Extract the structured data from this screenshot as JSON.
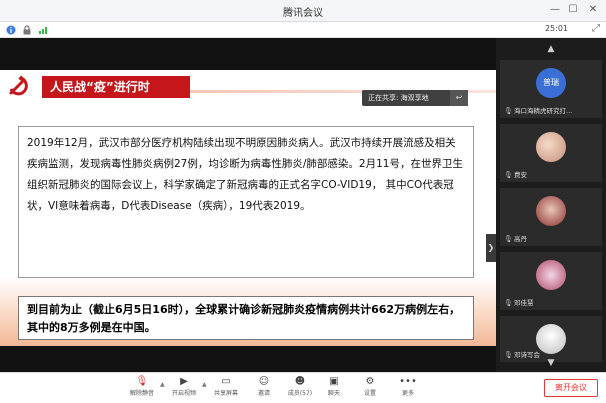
{
  "window": {
    "title": "腾讯会议"
  },
  "status": {
    "time": "25:01"
  },
  "slide": {
    "title": "人民战“疫”进行时",
    "share_tag": "正在共享: 海双享地",
    "paragraph1": "2019年12月，武汉市部分医疗机构陆续出现不明原因肺炎病人。武汉市持续开展流感及相关疾病监测，发现病毒性肺炎病例27例，均诊断为病毒性肺炎/肺部感染。2月11号，在世界卫生组织新冠肺炎的国际会议上，科学家确定了新冠病毒的正式名字CO-VID19， 其中CO代表冠状，VI意味着病毒，D代表Disease（疾病），19代表2019。",
    "paragraph2": "到目前为止（截止6月5日16时），全球累计确诊新冠肺炎疫情病例共计662万病例左右，其中的8万多例是在中国。"
  },
  "participants": [
    {
      "avatar_text": "普瑞",
      "name": "海口海精虎研究打..."
    },
    {
      "avatar_text": "",
      "name": "费安"
    },
    {
      "avatar_text": "",
      "name": "高丹"
    },
    {
      "avatar_text": "",
      "name": "邓佳慧"
    },
    {
      "avatar_text": "",
      "name": "邓诗写会"
    }
  ],
  "toolbar": {
    "items": [
      {
        "icon": "mic-icon",
        "label": "解除静音"
      },
      {
        "icon": "camera-icon",
        "label": "开启视频"
      },
      {
        "icon": "share-screen-icon",
        "label": "共享屏幕"
      },
      {
        "icon": "invite-icon",
        "label": "邀请"
      },
      {
        "icon": "members-icon",
        "label": "成员(57)"
      },
      {
        "icon": "chat-icon",
        "label": "聊天"
      },
      {
        "icon": "settings-icon",
        "label": "设置"
      },
      {
        "icon": "more-icon",
        "label": "更多"
      }
    ],
    "leave_label": "离开会议"
  },
  "colors": {
    "accent_red": "#c5171b",
    "leave_red": "#e53935",
    "panel_bg": "#1c1c1c"
  }
}
